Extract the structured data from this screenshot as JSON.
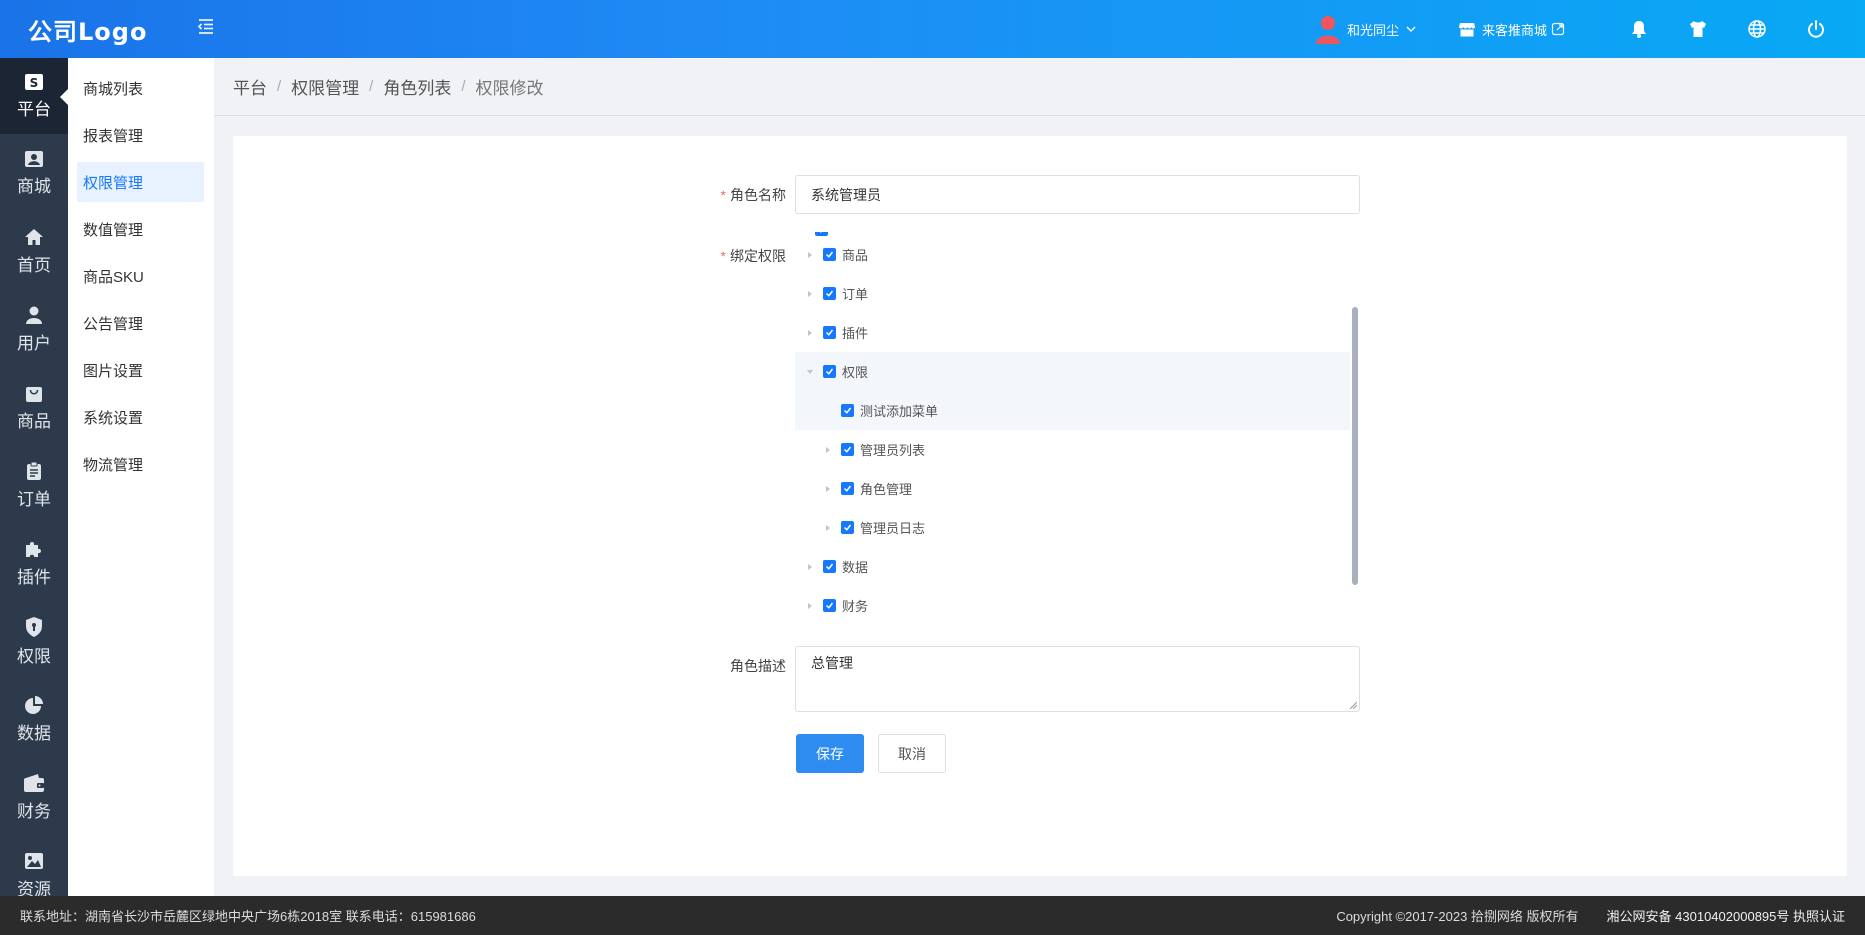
{
  "header": {
    "logo": "公司Logo",
    "user_name": "和光同尘",
    "store_label": "来客推商城"
  },
  "iconbar": [
    {
      "label": "平台",
      "icon": "s-badge-icon"
    },
    {
      "label": "商城",
      "icon": "shop-icon"
    },
    {
      "label": "首页",
      "icon": "home-icon"
    },
    {
      "label": "用户",
      "icon": "user-icon"
    },
    {
      "label": "商品",
      "icon": "bag-icon"
    },
    {
      "label": "订单",
      "icon": "clipboard-icon"
    },
    {
      "label": "插件",
      "icon": "puzzle-icon"
    },
    {
      "label": "权限",
      "icon": "shield-icon"
    },
    {
      "label": "数据",
      "icon": "pie-chart-icon"
    },
    {
      "label": "财务",
      "icon": "wallet-icon"
    },
    {
      "label": "资源",
      "icon": "image-icon"
    }
  ],
  "submenu": [
    {
      "label": "商城列表"
    },
    {
      "label": "报表管理"
    },
    {
      "label": "权限管理"
    },
    {
      "label": "数值管理"
    },
    {
      "label": "商品SKU"
    },
    {
      "label": "公告管理"
    },
    {
      "label": "图片设置"
    },
    {
      "label": "系统设置"
    },
    {
      "label": "物流管理"
    }
  ],
  "breadcrumb": [
    "平台",
    "权限管理",
    "角色列表",
    "权限修改"
  ],
  "form": {
    "role_name_label": "角色名称",
    "role_name_value": "系统管理员",
    "bind_perm_label": "绑定权限",
    "desc_label": "角色描述",
    "desc_value": "总管理",
    "save_label": "保存",
    "cancel_label": "取消"
  },
  "tree": [
    {
      "label": "商品",
      "level": 0,
      "expanded": false,
      "checked": true
    },
    {
      "label": "订单",
      "level": 0,
      "expanded": false,
      "checked": true
    },
    {
      "label": "插件",
      "level": 0,
      "expanded": false,
      "checked": true
    },
    {
      "label": "权限",
      "level": 0,
      "expanded": true,
      "checked": true
    },
    {
      "label": "测试添加菜单",
      "level": 1,
      "leaf": true,
      "checked": true
    },
    {
      "label": "管理员列表",
      "level": 1,
      "expanded": false,
      "checked": true
    },
    {
      "label": "角色管理",
      "level": 1,
      "expanded": false,
      "checked": true
    },
    {
      "label": "管理员日志",
      "level": 1,
      "expanded": false,
      "checked": true
    },
    {
      "label": "数据",
      "level": 0,
      "expanded": false,
      "checked": true
    },
    {
      "label": "财务",
      "level": 0,
      "expanded": false,
      "checked": true
    }
  ],
  "footer": {
    "address": "联系地址：湖南省长沙市岳麓区绿地中央广场6栋2018室 联系电话：615981686",
    "copyright": "Copyright ©2017-2023 拾捌网络 版权所有",
    "icp": "湘公网安备 43010402000895号 执照认证"
  }
}
